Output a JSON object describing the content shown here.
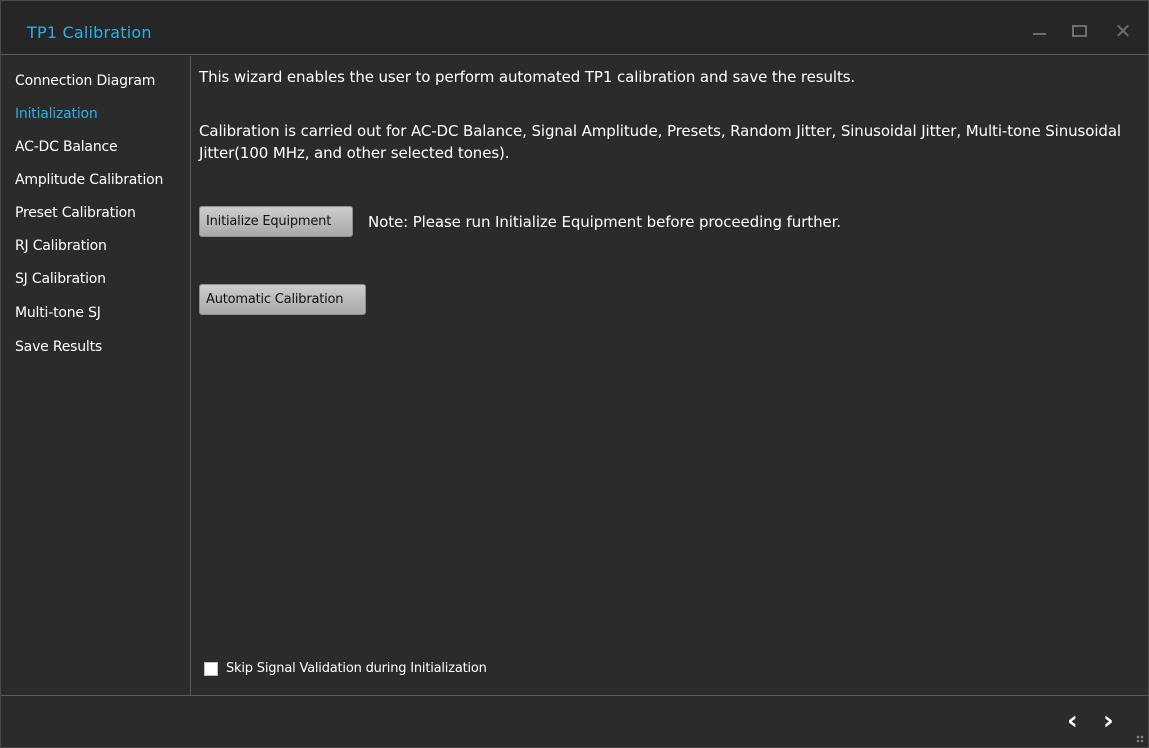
{
  "window": {
    "title": "TP1 Calibration",
    "controls": {
      "minimize_icon": "minimize-icon",
      "maximize_icon": "maximize-icon",
      "close_icon": "close-icon",
      "close_glyph": "✕"
    }
  },
  "sidebar": {
    "items": [
      {
        "label": "Connection Diagram",
        "active": false
      },
      {
        "label": "Initialization",
        "active": true
      },
      {
        "label": "AC-DC Balance",
        "active": false
      },
      {
        "label": "Amplitude Calibration",
        "active": false
      },
      {
        "label": "Preset Calibration",
        "active": false
      },
      {
        "label": "RJ Calibration",
        "active": false
      },
      {
        "label": "SJ Calibration",
        "active": false
      },
      {
        "label": "Multi-tone SJ",
        "active": false
      },
      {
        "label": "Save Results",
        "active": false
      }
    ]
  },
  "main": {
    "intro": "This wizard enables the user to perform automated TP1 calibration and save the results.",
    "description": "Calibration is carried out for AC-DC Balance, Signal Amplitude, Presets, Random Jitter, Sinusoidal Jitter, Multi-tone Sinusoidal Jitter(100 MHz, and other selected tones).",
    "init_button": "Initialize Equipment",
    "note": "Note: Please run Initialize Equipment before proceeding further.",
    "auto_button": "Automatic Calibration",
    "skip_label": "Skip Signal Validation during Initialization",
    "skip_checked": false
  },
  "footer": {
    "prev_glyph": "‹",
    "next_glyph": "›"
  },
  "colors": {
    "accent": "#2ab0e8",
    "background": "#2b2b2b",
    "text": "#ffffff"
  }
}
